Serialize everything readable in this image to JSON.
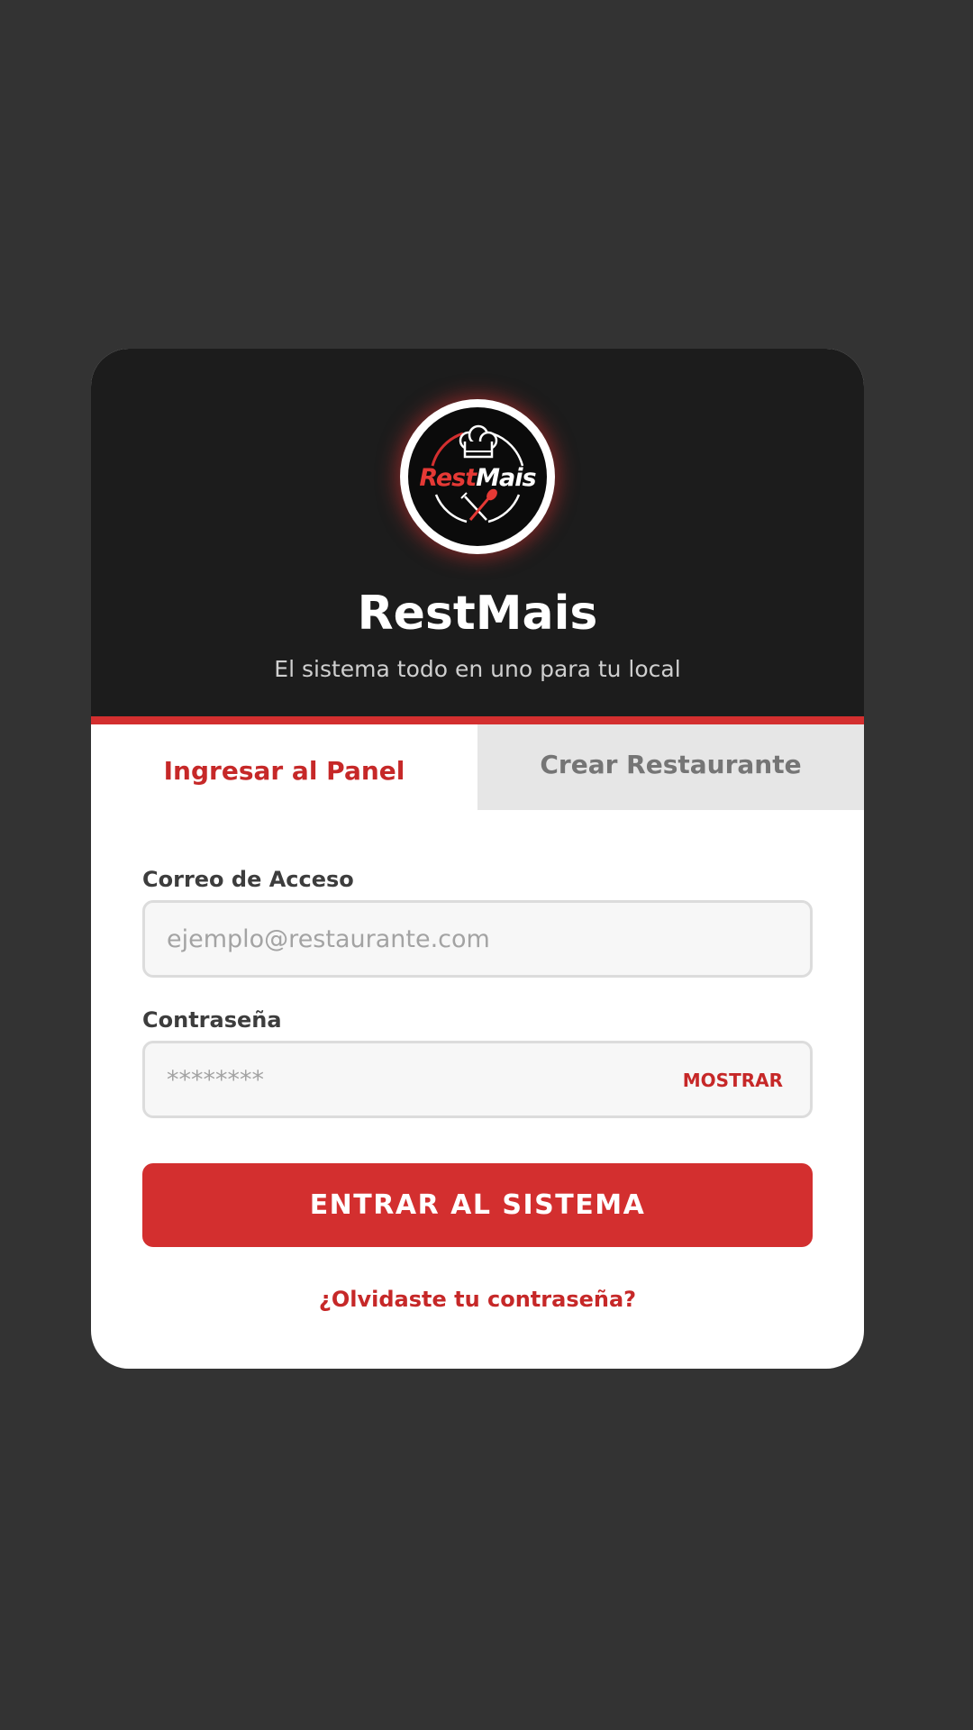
{
  "brand": {
    "logo_text_primary": "Rest",
    "logo_text_secondary": "Mais",
    "title": "RestMais",
    "subtitle": "El sistema todo en uno para tu local"
  },
  "tabs": [
    {
      "label": "Ingresar al Panel",
      "active": true
    },
    {
      "label": "Crear Restaurante",
      "active": false
    }
  ],
  "form": {
    "email": {
      "label": "Correo de Acceso",
      "placeholder": "ejemplo@restaurante.com",
      "value": ""
    },
    "password": {
      "label": "Contraseña",
      "placeholder": "********",
      "value": "",
      "toggle_label": "MOSTRAR"
    },
    "submit_label": "ENTRAR AL SISTEMA",
    "forgot_label": "¿Olvidaste tu contraseña?"
  },
  "icons": {
    "logo": "chef-hat-cutlery-logo-icon"
  },
  "colors": {
    "background": "#333333",
    "header": "#1c1c1c",
    "accent": "#d32f2f",
    "accent_text": "#c62828",
    "inactive_tab": "#e6e6e6"
  }
}
